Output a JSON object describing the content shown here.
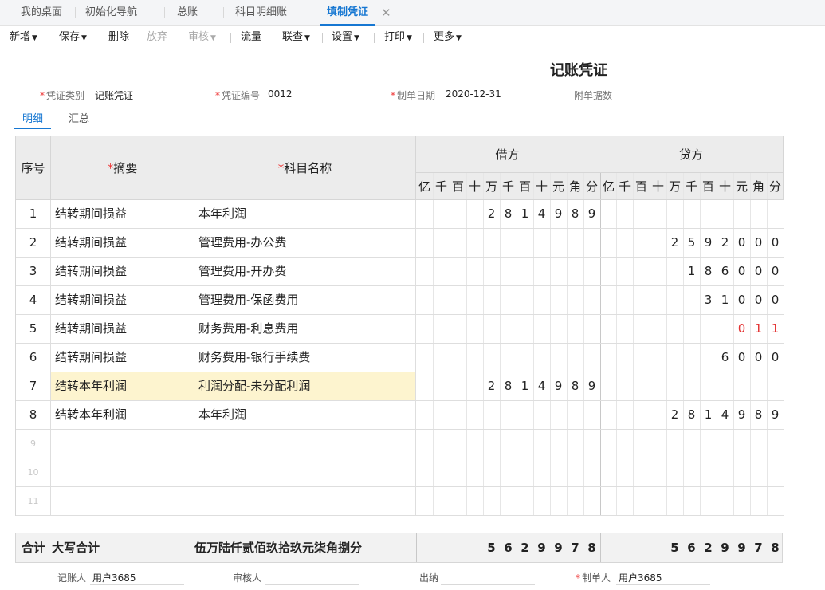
{
  "tabs": [
    {
      "label": "我的桌面"
    },
    {
      "label": "初始化导航"
    },
    {
      "label": "总账"
    },
    {
      "label": "科目明细账"
    },
    {
      "label": "填制凭证"
    }
  ],
  "toolbar": {
    "add": "新增",
    "save": "保存",
    "delete": "删除",
    "discard": "放弃",
    "review": "审核",
    "cashflow": "流量",
    "query": "联查",
    "settings": "设置",
    "print": "打印",
    "more": "更多"
  },
  "voucher": {
    "title": "记账凭证",
    "type_label": "凭证类别",
    "type_value": "记账凭证",
    "number_label": "凭证编号",
    "number_value": "0012",
    "date_label": "制单日期",
    "date_value": "2020-12-31",
    "attachments_label": "附单据数",
    "attachments_value": ""
  },
  "subtabs": {
    "detail": "明细",
    "summary": "汇总"
  },
  "table": {
    "headers": {
      "no": "序号",
      "summary": "摘要",
      "account": "科目名称",
      "debit": "借方",
      "credit": "贷方",
      "required_mark": "*"
    },
    "digit_headers": [
      "亿",
      "千",
      "百",
      "十",
      "万",
      "千",
      "百",
      "十",
      "元",
      "角",
      "分"
    ],
    "rows": [
      {
        "no": "1",
        "summary": "结转期间损益",
        "account": "本年利润",
        "debit": "2814989",
        "credit": ""
      },
      {
        "no": "2",
        "summary": "结转期间损益",
        "account": "管理费用-办公费",
        "debit": "",
        "credit": "2592000"
      },
      {
        "no": "3",
        "summary": "结转期间损益",
        "account": "管理费用-开办费",
        "debit": "",
        "credit": "186000"
      },
      {
        "no": "4",
        "summary": "结转期间损益",
        "account": "管理费用-保函费用",
        "debit": "",
        "credit": "31000"
      },
      {
        "no": "5",
        "summary": "结转期间损益",
        "account": "财务费用-利息费用",
        "debit": "",
        "credit": "011",
        "credit_color": "#e33333"
      },
      {
        "no": "6",
        "summary": "结转期间损益",
        "account": "财务费用-银行手续费",
        "debit": "",
        "credit": "6000"
      },
      {
        "no": "7",
        "summary": "结转本年利润",
        "account": "利润分配-未分配利润",
        "debit": "2814989",
        "credit": ""
      },
      {
        "no": "8",
        "summary": "结转本年利润",
        "account": "本年利润",
        "debit": "",
        "credit": "2814989"
      },
      {
        "no": "9",
        "summary": "",
        "account": "",
        "debit": "",
        "credit": ""
      },
      {
        "no": "10",
        "summary": "",
        "account": "",
        "debit": "",
        "credit": ""
      },
      {
        "no": "11",
        "summary": "",
        "account": "",
        "debit": "",
        "credit": ""
      }
    ]
  },
  "totals": {
    "label": "合计",
    "words_label": "大写合计",
    "words": "伍万陆仟贰佰玖拾玖元柒角捌分",
    "debit": "5629978",
    "credit": "5629978"
  },
  "footer": {
    "bookkeeper_label": "记账人",
    "bookkeeper_value": "用户3685",
    "reviewer_label": "审核人",
    "reviewer_value": "",
    "cashier_label": "出纳",
    "cashier_value": "",
    "preparer_label": "制单人",
    "preparer_value": "用户3685"
  }
}
